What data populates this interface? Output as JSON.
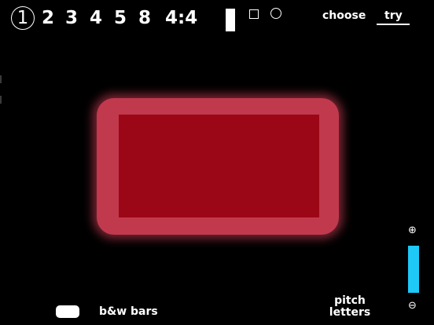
{
  "beats": {
    "items": [
      "1",
      "2",
      "3",
      "4",
      "5",
      "8",
      "4:4"
    ],
    "selected": "1"
  },
  "shapes": {
    "bar_icon": "bar-icon",
    "square_icon": "square-icon",
    "circle_icon": "circle-icon"
  },
  "modes": {
    "choose_label": "choose",
    "try_label": "try",
    "active": "try"
  },
  "note": {
    "outer_color": "#c1394d",
    "inner_color": "#9b0716"
  },
  "zoom": {
    "in_symbol": "⊕",
    "out_symbol": "⊖",
    "level": 1.0,
    "color": "#1ec8f7"
  },
  "footer": {
    "bw_bars_label": "b&w bars",
    "pitch_line1": "pitch",
    "pitch_line2": "letters"
  }
}
